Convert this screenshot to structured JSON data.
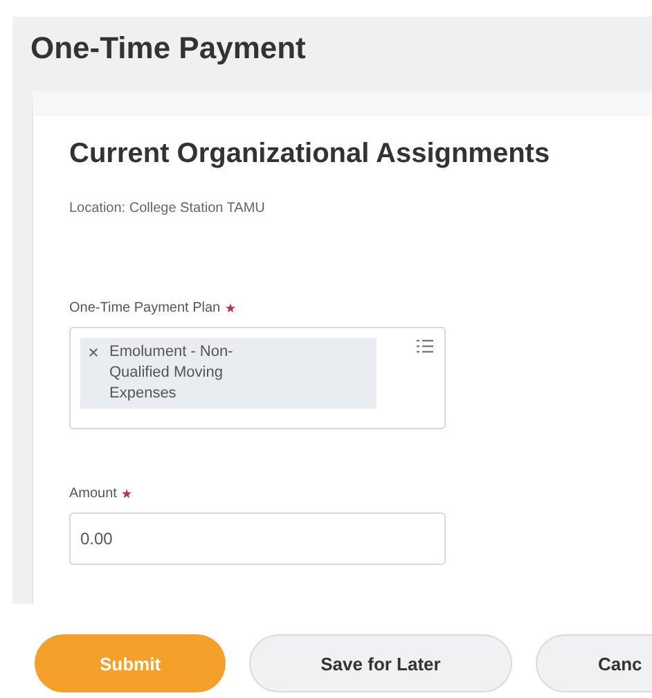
{
  "page": {
    "title": "One-Time Payment"
  },
  "section": {
    "title": "Current Organizational Assignments",
    "location": "Location: College Station TAMU"
  },
  "fields": [
    {
      "kind": "multiselect",
      "label": "One-Time Payment Plan",
      "required": true,
      "items": [
        "Emolument - Non-Qualified Moving Expenses"
      ]
    },
    {
      "kind": "text",
      "label": "Amount",
      "required": true,
      "value": "0.00"
    }
  ],
  "buttons": [
    {
      "label": "Submit",
      "kind": "primary"
    },
    {
      "label": "Save for Later",
      "kind": "secondary"
    },
    {
      "label": "Canc",
      "kind": "secondary"
    }
  ]
}
